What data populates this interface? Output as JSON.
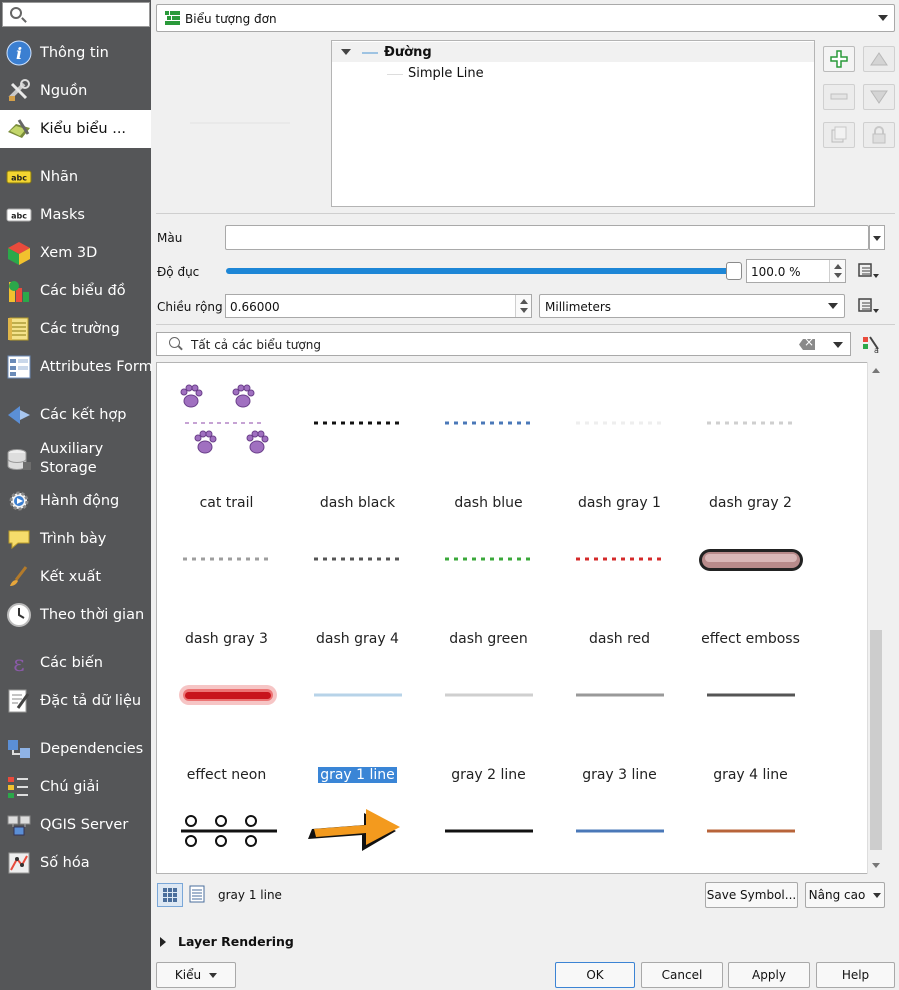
{
  "sidebar": {
    "items": [
      {
        "label": "Thông tin",
        "icon": "info-icon"
      },
      {
        "label": "Nguồn",
        "icon": "tools-icon"
      },
      {
        "label": "Kiểu biểu ...",
        "icon": "paintbrush-icon",
        "active": true
      },
      {
        "label": "Nhãn",
        "icon": "abc-label-icon"
      },
      {
        "label": "Masks",
        "icon": "abc-mask-icon"
      },
      {
        "label": "Xem 3D",
        "icon": "cube-3d-icon"
      },
      {
        "label": "Các biểu đồ",
        "icon": "diagram-icon"
      },
      {
        "label": "Các trường",
        "icon": "fields-icon"
      },
      {
        "label": "Attributes Form",
        "icon": "form-icon"
      },
      {
        "label": "Các kết hợp",
        "icon": "joins-icon"
      },
      {
        "label": "Auxiliary Storage",
        "icon": "database-icon"
      },
      {
        "label": "Hành động",
        "icon": "gear-action-icon"
      },
      {
        "label": "Trình bày",
        "icon": "speech-bubble-icon"
      },
      {
        "label": "Kết xuất",
        "icon": "brush-render-icon"
      },
      {
        "label": "Theo thời gian",
        "icon": "clock-icon"
      },
      {
        "label": "Các biến",
        "icon": "epsilon-icon"
      },
      {
        "label": "Đặc tả dữ liệu",
        "icon": "metadata-icon"
      },
      {
        "label": "Dependencies",
        "icon": "dependencies-icon"
      },
      {
        "label": "Chú giải",
        "icon": "legend-icon"
      },
      {
        "label": "QGIS Server",
        "icon": "server-icon"
      },
      {
        "label": "Số hóa",
        "icon": "digitize-icon"
      }
    ]
  },
  "renderer": {
    "label": "Biểu tượng đơn"
  },
  "symbol_tree": {
    "root": "Đường",
    "child": "Simple Line"
  },
  "fields": {
    "color_label": "Màu",
    "opacity_label": "Độ đục",
    "opacity_value": "100.0 %",
    "opacity_level": 1.0,
    "width_label": "Chiều rộng",
    "width_value": "0.66000",
    "unit_value": "Millimeters"
  },
  "search": {
    "placeholder": "Tất cả các biểu tượng"
  },
  "gallery": {
    "rows": [
      [
        "cat trail",
        "dash  black",
        "dash blue",
        "dash gray 1",
        "dash gray 2"
      ],
      [
        "dash gray 3",
        "dash gray 4",
        "dash green",
        "dash red",
        "effect emboss"
      ],
      [
        "effect neon",
        "gray 1 line",
        "gray 2 line",
        "gray 3 line",
        "gray 4 line"
      ]
    ],
    "selected": "gray 1 line"
  },
  "footer": {
    "selected_name": "gray 1 line",
    "save_symbol": "Save Symbol...",
    "advanced": "Nâng cao",
    "layer_rendering": "Layer Rendering",
    "style": "Kiểu",
    "ok": "OK",
    "cancel": "Cancel",
    "apply": "Apply",
    "help": "Help"
  },
  "colors": {
    "sidebar_bg": "#555658",
    "selection": "#3a85d6",
    "slider": "#1d86d6"
  }
}
